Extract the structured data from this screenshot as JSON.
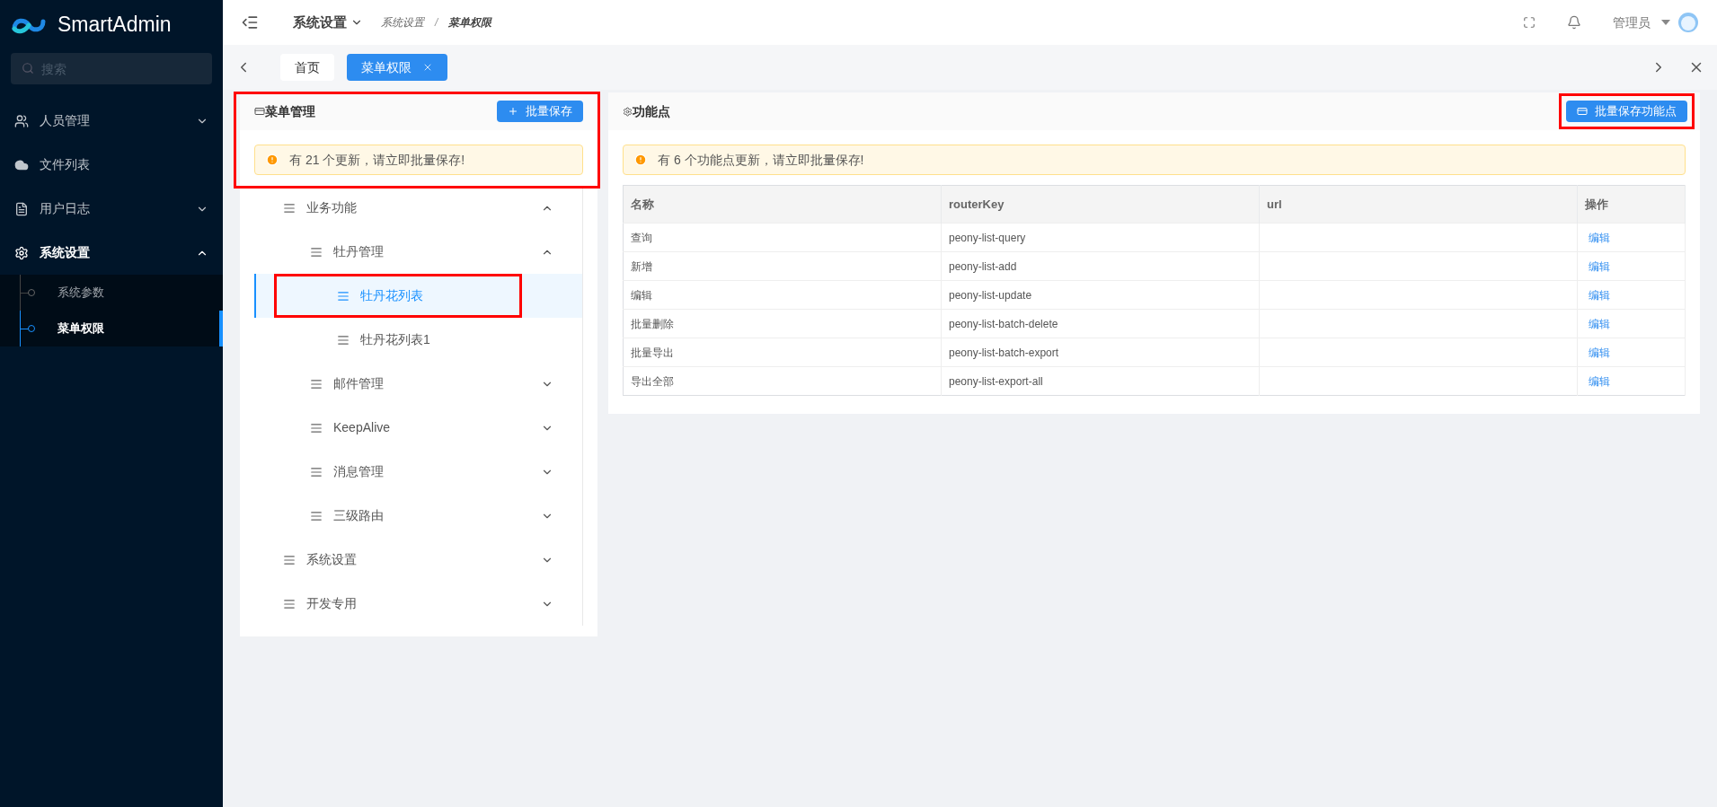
{
  "sidebar": {
    "logo": "SmartAdmin",
    "search": {
      "placeholder": "搜索"
    },
    "items": [
      {
        "label": "人员管理",
        "kind": "user",
        "expanded": false,
        "selected": false
      },
      {
        "label": "文件列表",
        "kind": "cloud",
        "selected": false
      },
      {
        "label": "用户日志",
        "kind": "log",
        "expanded": false,
        "selected": false
      },
      {
        "label": "系统设置",
        "kind": "gear",
        "expanded": true,
        "selected": false,
        "children": [
          {
            "label": "系统参数",
            "selected": false
          },
          {
            "label": "菜单权限",
            "selected": true
          }
        ]
      }
    ]
  },
  "header": {
    "module": "系统设置",
    "breadcrumb": [
      "系统设置",
      "菜单权限"
    ],
    "separator": "/",
    "user": "管理员"
  },
  "tabs": [
    {
      "label": "首页",
      "selected": false,
      "closable": false
    },
    {
      "label": "菜单权限",
      "selected": true,
      "closable": true
    }
  ],
  "menu_panel": {
    "title": "菜单管理",
    "button": "批量保存",
    "alert": "有 21 个更新，请立即批量保存!",
    "tree": [
      {
        "label": "业务功能",
        "expanded": true,
        "selected": false,
        "children": [
          {
            "label": "牡丹管理",
            "expanded": true,
            "selected": false,
            "children": [
              {
                "label": "牡丹花列表",
                "selected": true
              },
              {
                "label": "牡丹花列表1",
                "selected": false
              }
            ]
          },
          {
            "label": "邮件管理",
            "expanded": false,
            "selected": false
          },
          {
            "label": "KeepAlive",
            "expanded": false,
            "selected": false
          },
          {
            "label": "消息管理",
            "expanded": false,
            "selected": false
          },
          {
            "label": "三级路由",
            "expanded": false,
            "selected": false
          }
        ]
      },
      {
        "label": "系统设置",
        "expanded": false,
        "selected": false
      },
      {
        "label": "开发专用",
        "expanded": false,
        "selected": false
      }
    ]
  },
  "function_panel": {
    "title": "功能点",
    "button": "批量保存功能点",
    "alert": "有 6 个功能点更新，请立即批量保存!",
    "table": {
      "columns": [
        "名称",
        "routerKey",
        "url",
        "操作"
      ],
      "rows": [
        [
          "查询",
          "peony-list-query",
          "",
          "编辑"
        ],
        [
          "新增",
          "peony-list-add",
          "",
          "编辑"
        ],
        [
          "编辑",
          "peony-list-update",
          "",
          "编辑"
        ],
        [
          "批量删除",
          "peony-list-batch-delete",
          "",
          "编辑"
        ],
        [
          "批量导出",
          "peony-list-batch-export",
          "",
          "编辑"
        ],
        [
          "导出全部",
          "peony-list-export-all",
          "",
          "编辑"
        ]
      ]
    }
  }
}
